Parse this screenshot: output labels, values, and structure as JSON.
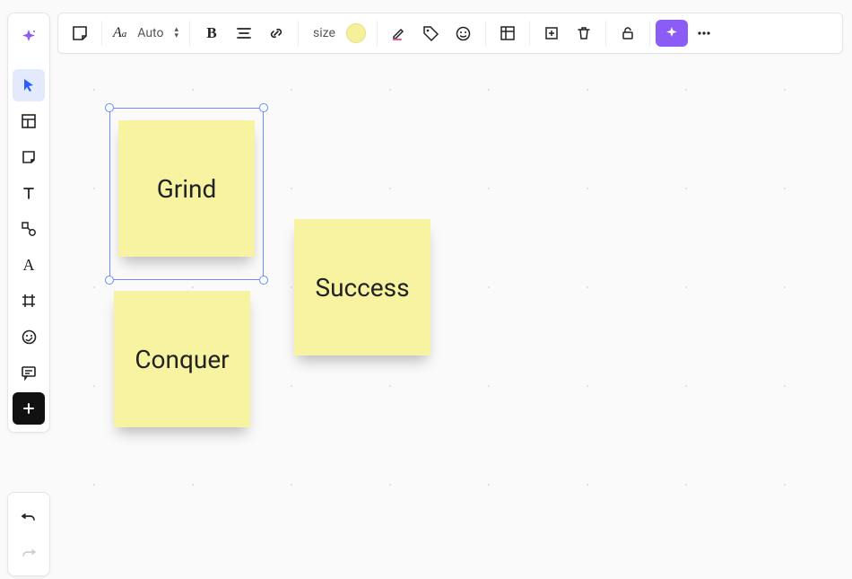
{
  "toolbar": {
    "font_mode": "Auto",
    "size_label": "size",
    "color_swatch": "#f7f09a"
  },
  "notes": {
    "n1": {
      "text": "Grind"
    },
    "n2": {
      "text": "Conquer"
    },
    "n3": {
      "text": "Success"
    }
  }
}
